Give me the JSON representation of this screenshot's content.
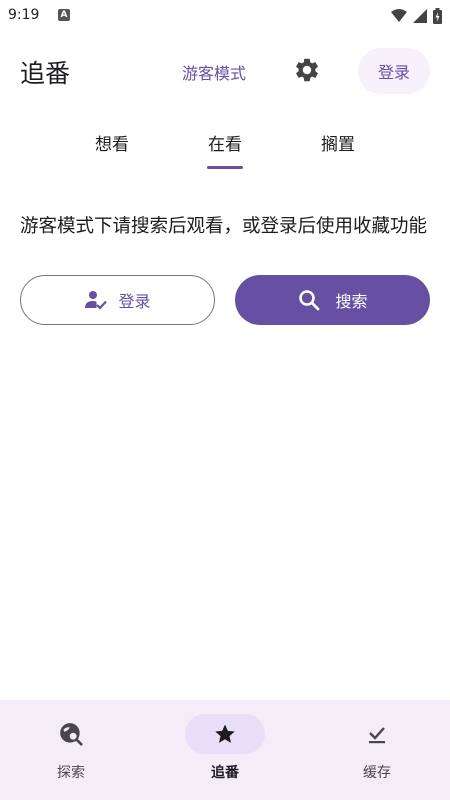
{
  "status_bar": {
    "time": "9:19",
    "notification_icon": "A"
  },
  "top_bar": {
    "title": "追番",
    "guest_mode_label": "游客模式",
    "settings_icon": "gear-icon",
    "login_label": "登录"
  },
  "tabs": [
    {
      "label": "想看",
      "selected": false
    },
    {
      "label": "在看",
      "selected": true
    },
    {
      "label": "搁置",
      "selected": false
    }
  ],
  "message": "游客模式下请搜索后观看，或登录后使用收藏功能",
  "actions": {
    "login_label": "登录",
    "search_label": "搜索"
  },
  "bottom_nav": [
    {
      "label": "探索",
      "icon": "explore-search-icon",
      "selected": false
    },
    {
      "label": "追番",
      "icon": "star-icon",
      "selected": true
    },
    {
      "label": "缓存",
      "icon": "download-done-icon",
      "selected": false
    }
  ],
  "colors": {
    "primary": "#6750a4",
    "nav_background": "#f3edf7",
    "nav_active_indicator": "#e8def8",
    "login_chip_background": "#f6f1fb"
  }
}
